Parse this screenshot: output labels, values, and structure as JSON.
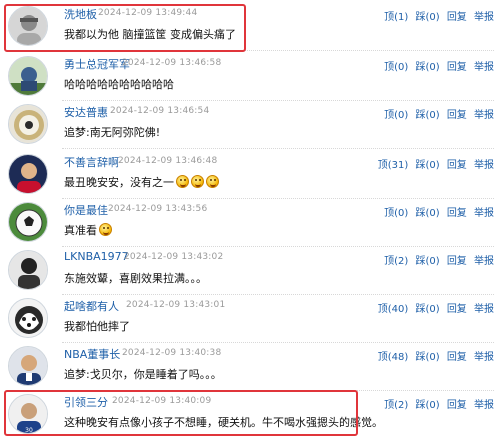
{
  "comments": [
    {
      "name": "洗地板",
      "time": "2024-12-09 13:49:44",
      "text": "我都以为他 脑撞篮筐 变成偏头痛了",
      "up": "顶(1)",
      "down": "踩(0)",
      "reply": "回复",
      "report": "举报",
      "avatar_icon": "user-avatar-icon"
    },
    {
      "name": "勇士总冠军军",
      "time": "2024-12-09 13:46:58",
      "text": "哈哈哈哈哈哈哈哈哈哈",
      "up": "顶(0)",
      "down": "踩(0)",
      "reply": "回复",
      "report": "举报",
      "avatar_icon": "user-avatar-icon"
    },
    {
      "name": "安达普惠",
      "time": "2024-12-09 13:46:54",
      "text": "追梦:南无阿弥陀佛!",
      "up": "顶(0)",
      "down": "踩(0)",
      "reply": "回复",
      "report": "举报",
      "avatar_icon": "user-avatar-icon"
    },
    {
      "name": "不善言辞啊",
      "time": "2024-12-09 13:46:48",
      "text": "最丑晚安安，没有之一",
      "up": "顶(31)",
      "down": "踩(0)",
      "reply": "回复",
      "report": "举报",
      "avatar_icon": "user-avatar-icon",
      "emojis": 3
    },
    {
      "name": "你是最佳",
      "time": "2024-12-09 13:43:56",
      "text": "真准看",
      "up": "顶(0)",
      "down": "踩(0)",
      "reply": "回复",
      "report": "举报",
      "avatar_icon": "soccer-ball-icon",
      "emojis": 1
    },
    {
      "name": "LKNBA1977",
      "time": "2024-12-09 13:43:02",
      "text": "东施效颦，喜剧效果拉满。。。",
      "up": "顶(2)",
      "down": "踩(0)",
      "reply": "回复",
      "report": "举报",
      "avatar_icon": "user-avatar-icon"
    },
    {
      "name": "起啥都有人",
      "time": "2024-12-09 13:43:01",
      "text": "我都怕他摔了",
      "up": "顶(40)",
      "down": "踩(0)",
      "reply": "回复",
      "report": "举报",
      "avatar_icon": "husky-dog-icon"
    },
    {
      "name": "NBA董事长",
      "time": "2024-12-09 13:40:38",
      "text": "追梦:戈贝尔，你是睡着了吗。。。",
      "up": "顶(48)",
      "down": "踩(0)",
      "reply": "回复",
      "report": "举报",
      "avatar_icon": "user-avatar-icon"
    },
    {
      "name": "引领三分",
      "time": "2024-12-09 13:40:09",
      "text": "这种晚安有点像小孩子不想睡，硬关机。牛不喝水强摁头的感觉。",
      "up": "顶(2)",
      "down": "踩(0)",
      "reply": "回复",
      "report": "举报",
      "avatar_icon": "user-avatar-icon"
    }
  ],
  "highlight_color": "#e0353b",
  "link_color": "#1e5fa8"
}
